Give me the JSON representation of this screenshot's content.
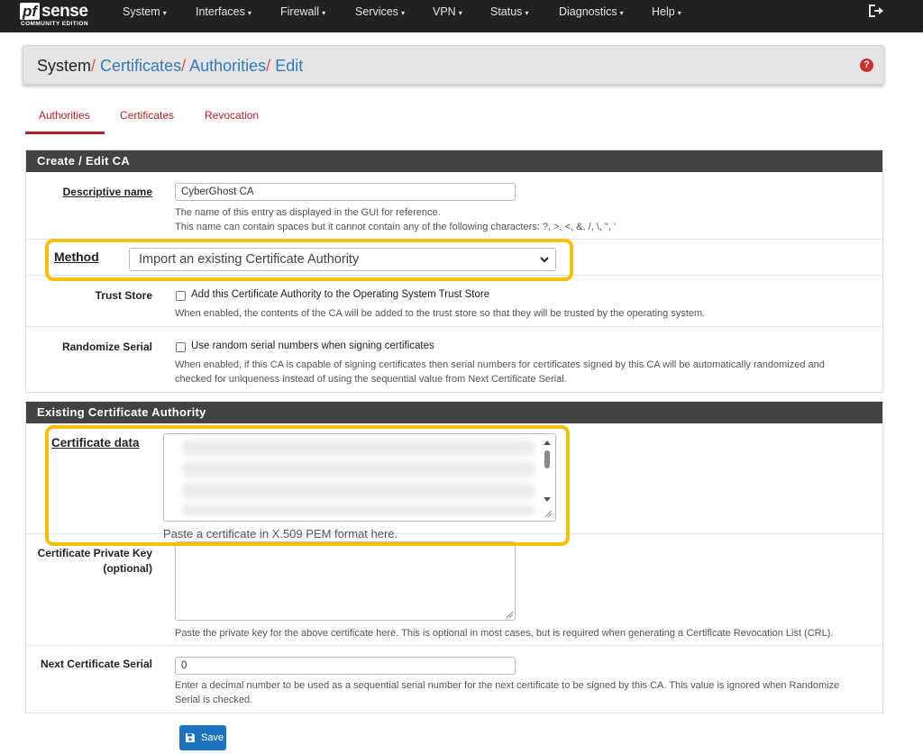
{
  "brand": {
    "logo_pf": "pf",
    "logo_sense": "sense",
    "edition": "COMMUNITY EDITION"
  },
  "nav": {
    "items": [
      {
        "label": "System"
      },
      {
        "label": "Interfaces"
      },
      {
        "label": "Firewall"
      },
      {
        "label": "Services"
      },
      {
        "label": "VPN"
      },
      {
        "label": "Status"
      },
      {
        "label": "Diagnostics"
      },
      {
        "label": "Help"
      }
    ],
    "caret": "▾",
    "logout_icon": "logout-icon"
  },
  "breadcrumb": {
    "root": "System",
    "items": [
      "Certificates",
      "Authorities",
      "Edit"
    ],
    "separator": "/",
    "help_icon_text": "?"
  },
  "tabs": [
    {
      "label": "Authorities",
      "active": true
    },
    {
      "label": "Certificates",
      "active": false
    },
    {
      "label": "Revocation",
      "active": false
    }
  ],
  "create_panel": {
    "title": "Create / Edit CA",
    "descriptive_name": {
      "label": "Descriptive name",
      "value": "CyberGhost CA",
      "help1": "The name of this entry as displayed in the GUI for reference.",
      "help2": "This name can contain spaces but it cannot contain any of the following characters: ?, >, <, &, /, \\, \", '"
    },
    "method": {
      "label": "Method",
      "selected": "Import an existing Certificate Authority"
    },
    "trust_store": {
      "label": "Trust Store",
      "checkbox_label": "Add this Certificate Authority to the Operating System Trust Store",
      "checked": false,
      "help": "When enabled, the contents of the CA will be added to the trust store so that they will be trusted by the operating system."
    },
    "randomize_serial": {
      "label": "Randomize Serial",
      "checkbox_label": "Use random serial numbers when signing certificates",
      "checked": false,
      "help1": "When enabled, if this CA is capable of signing certificates then serial numbers for certificates signed by this CA will be automatically randomized and",
      "help2": "checked for uniqueness instead of using the sequential value from Next Certificate Serial."
    }
  },
  "existing_panel": {
    "title": "Existing Certificate Authority",
    "certificate_data": {
      "label": "Certificate data",
      "help": "Paste a certificate in X.509 PEM format here."
    },
    "private_key": {
      "label_line1": "Certificate Private Key",
      "label_line2": "(optional)",
      "help": "Paste the private key for the above certificate here. This is optional in most cases, but is required when generating a Certificate Revocation List (CRL)."
    },
    "next_serial": {
      "label": "Next Certificate Serial",
      "value": "0",
      "help1": "Enter a decimal number to be used as a sequential serial number for the next certificate to be signed by this CA. This value is ignored when Randomize",
      "help2": "Serial is checked."
    }
  },
  "save_button": {
    "label": "Save",
    "icon": "save-icon"
  },
  "colors": {
    "navbar": "#212121",
    "panel_header": "#424242",
    "tab_active": "#b32025",
    "link": "#337ab7",
    "highlight": "#f5c000",
    "save": "#1e73be"
  }
}
